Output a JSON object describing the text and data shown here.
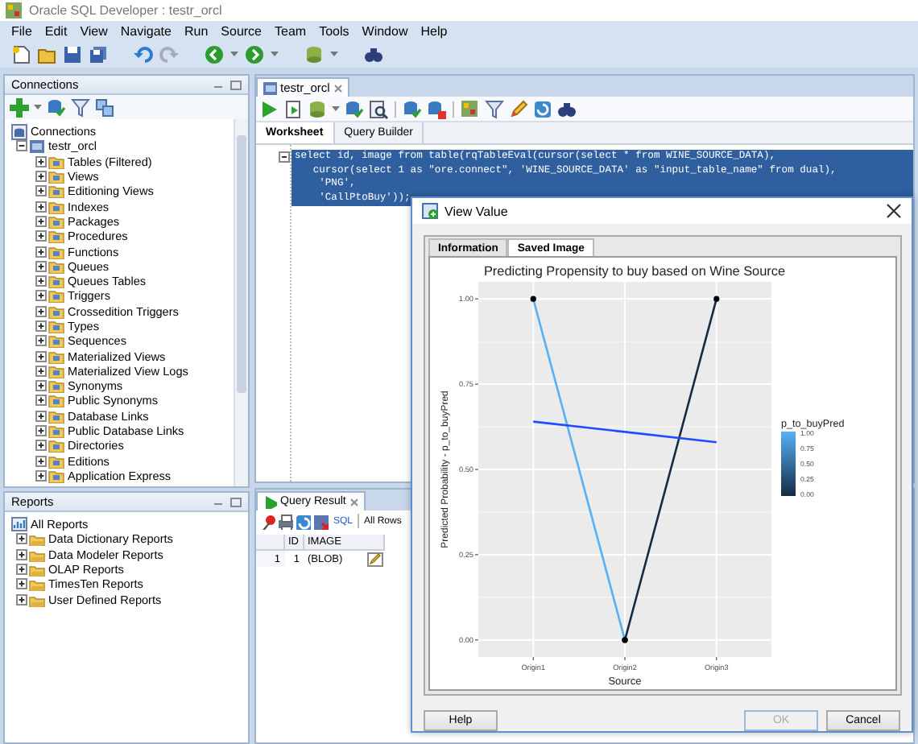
{
  "window": {
    "title": "Oracle SQL Developer : testr_orcl"
  },
  "menu": [
    "File",
    "Edit",
    "View",
    "Navigate",
    "Run",
    "Source",
    "Team",
    "Tools",
    "Window",
    "Help"
  ],
  "connections": {
    "title": "Connections",
    "tree": [
      {
        "label": "Connections",
        "children": [
          {
            "label": "testr_orcl",
            "expanded": true,
            "children": [
              {
                "label": "Tables (Filtered)",
                "expanded": false
              },
              {
                "label": "Views",
                "expanded": false
              },
              {
                "label": "Editioning Views",
                "expanded": false
              },
              {
                "label": "Indexes",
                "expanded": false
              },
              {
                "label": "Packages",
                "expanded": false
              },
              {
                "label": "Procedures",
                "expanded": false
              },
              {
                "label": "Functions",
                "expanded": false
              },
              {
                "label": "Queues",
                "expanded": false
              },
              {
                "label": "Queues Tables",
                "expanded": false
              },
              {
                "label": "Triggers",
                "expanded": false
              },
              {
                "label": "Crossedition Triggers",
                "expanded": false
              },
              {
                "label": "Types",
                "expanded": false
              },
              {
                "label": "Sequences",
                "expanded": false
              },
              {
                "label": "Materialized Views",
                "expanded": false
              },
              {
                "label": "Materialized View Logs",
                "expanded": false
              },
              {
                "label": "Synonyms",
                "expanded": false
              },
              {
                "label": "Public Synonyms",
                "expanded": false
              },
              {
                "label": "Database Links",
                "expanded": false
              },
              {
                "label": "Public Database Links",
                "expanded": false
              },
              {
                "label": "Directories",
                "expanded": false
              },
              {
                "label": "Editions",
                "expanded": false
              },
              {
                "label": "Application Express",
                "expanded": false
              }
            ]
          }
        ]
      }
    ]
  },
  "reports": {
    "title": "Reports",
    "tree": [
      {
        "label": "All Reports",
        "children": [
          {
            "label": "Data Dictionary Reports",
            "expanded": false
          },
          {
            "label": "Data Modeler Reports",
            "expanded": false
          },
          {
            "label": "OLAP Reports",
            "expanded": false
          },
          {
            "label": "TimesTen Reports",
            "expanded": false
          },
          {
            "label": "User Defined Reports",
            "expanded": false
          }
        ]
      }
    ]
  },
  "editor": {
    "tab": "testr_orcl",
    "subtabs": [
      {
        "label": "Worksheet",
        "selected": true
      },
      {
        "label": "Query Builder",
        "selected": false
      }
    ],
    "code": [
      {
        "text": "select id, image from table(rqTableEval(cursor(select * from WINE_SOURCE_DATA),",
        "selected": true
      },
      {
        "text": "   cursor(select 1 as \"ore.connect\", 'WINE_SOURCE_DATA' as \"input_table_name\" from dual),",
        "selected": true
      },
      {
        "text": "    'PNG',",
        "selected": true
      },
      {
        "text": "    'CallPtoBuy'));",
        "selected": true
      }
    ]
  },
  "query_result": {
    "tab": "Query Result",
    "sql_link": "SQL",
    "rows_label": "All Rows",
    "columns": [
      "ID",
      "IMAGE"
    ],
    "rows": [
      {
        "number": "1",
        "cells": [
          "1",
          "(BLOB)"
        ]
      }
    ]
  },
  "dialog": {
    "title": "View Value",
    "tabs": [
      {
        "label": "Information",
        "selected": false
      },
      {
        "label": "Saved Image",
        "selected": true
      }
    ],
    "chart_data": {
      "type": "line",
      "title": "Predicting Propensity to buy based on Wine Source",
      "xlabel": "Source",
      "ylabel": "Predicted Probability - p_to_buyPred",
      "categories": [
        "Origin1",
        "Origin2",
        "Origin3"
      ],
      "series": [
        {
          "color": "#56b1f7",
          "values": [
            1,
            0,
            null
          ],
          "marker": "circle"
        },
        {
          "color": "#132b43",
          "values": [
            null,
            0,
            1
          ],
          "marker": "circle"
        },
        {
          "color": "#1f4dff",
          "values": [
            0.64,
            0.61,
            0.58
          ]
        }
      ],
      "grid": true,
      "ylim": [
        -0.05,
        1.05
      ],
      "yticks": [
        {
          "value": 0,
          "label": "0.00"
        },
        {
          "value": 0.25,
          "label": "0.25"
        },
        {
          "value": 0.5,
          "label": "0.50"
        },
        {
          "value": 0.75,
          "label": "0.75"
        },
        {
          "value": 1,
          "label": "1.00"
        }
      ]
    },
    "legend": {
      "title": "p_to_buyPred",
      "labels": [
        "1.00",
        "0.75",
        "0.50",
        "0.25",
        "0.00"
      ]
    },
    "buttons": [
      {
        "label": "Help",
        "disabled": false
      },
      {
        "label": "OK",
        "disabled": true
      },
      {
        "label": "Cancel",
        "disabled": false
      }
    ]
  }
}
